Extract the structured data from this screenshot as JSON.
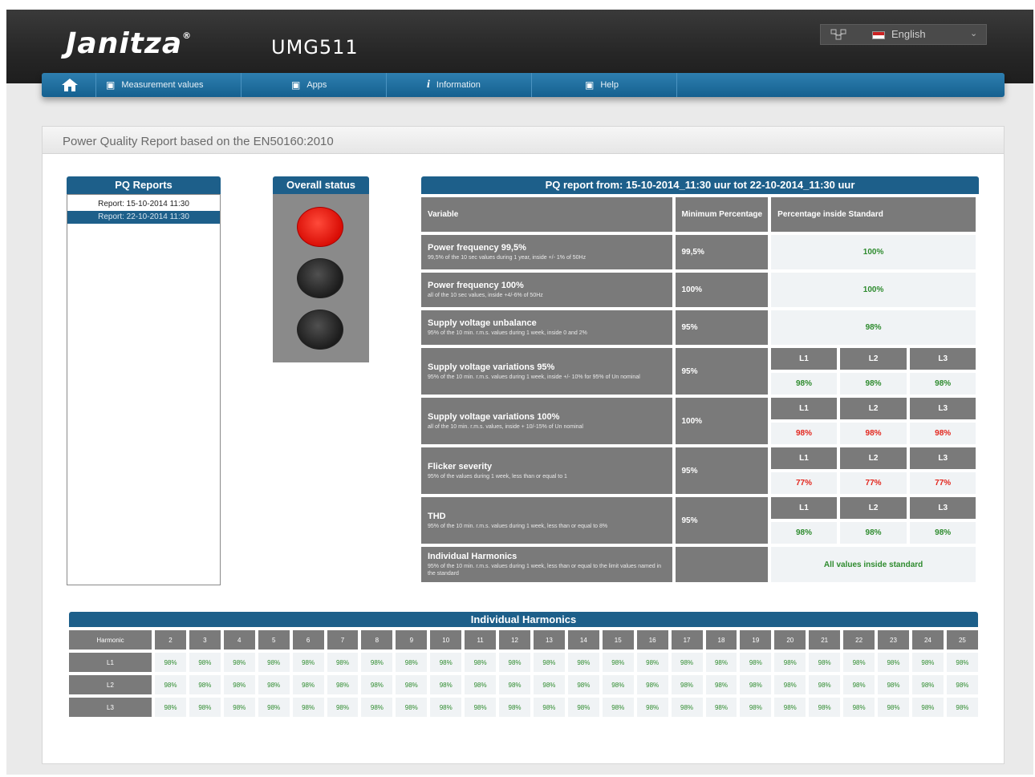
{
  "header": {
    "brand": "Janitza",
    "brand_mark": "®",
    "model": "UMG511",
    "network_icon": "network-icon",
    "language": "English"
  },
  "nav": {
    "home_icon": "home-icon",
    "items": [
      {
        "label": "Measurement values",
        "icon": "monitor-icon"
      },
      {
        "label": "Apps",
        "icon": "apps-icon"
      },
      {
        "label": "Information",
        "icon": "info-icon"
      },
      {
        "label": "Help",
        "icon": "help-icon"
      }
    ]
  },
  "page_title": "Power Quality Report based on the EN50160:2010",
  "reports": {
    "title": "PQ Reports",
    "items": [
      "Report: 15-10-2014 11:30",
      "Report: 22-10-2014 11:30"
    ],
    "selected_index": 1
  },
  "status": {
    "title": "Overall status",
    "active_light": "red"
  },
  "pq": {
    "title": "PQ report from: 15-10-2014_11:30 uur tot 22-10-2014_11:30 uur",
    "col_variable": "Variable",
    "col_min": "Minimum Percentage",
    "col_inside": "Percentage inside Standard",
    "phases": [
      "L1",
      "L2",
      "L3"
    ],
    "rows": [
      {
        "name": "Power frequency 99,5%",
        "desc": "99,5% of the 10 sec values during 1 year, inside +/- 1% of 50Hz",
        "min": "99,5%",
        "value": "100%",
        "status": "ok"
      },
      {
        "name": "Power frequency 100%",
        "desc": "all of the 10 sec values, inside +4/-6% of 50Hz",
        "min": "100%",
        "value": "100%",
        "status": "ok"
      },
      {
        "name": "Supply voltage unbalance",
        "desc": "95% of the 10 min. r.m.s. values during 1 week, inside 0 and 2%",
        "min": "95%",
        "value": "98%",
        "status": "ok"
      },
      {
        "name": "Supply voltage variations 95%",
        "desc": "95% of the 10 min. r.m.s. values during 1 week, inside +/- 10% for 95% of Un nominal",
        "min": "95%",
        "values": [
          "98%",
          "98%",
          "98%"
        ],
        "status": "ok"
      },
      {
        "name": "Supply voltage variations 100%",
        "desc": "all of the 10 min. r.m.s. values, inside + 10/-15% of Un nominal",
        "min": "100%",
        "values": [
          "98%",
          "98%",
          "98%"
        ],
        "status": "bad"
      },
      {
        "name": "Flicker severity",
        "desc": "95% of the values during 1 week, less than or equal to 1",
        "min": "95%",
        "values": [
          "77%",
          "77%",
          "77%"
        ],
        "status": "bad"
      },
      {
        "name": "THD",
        "desc": "95% of the 10 min. r.m.s. values during 1 week, less than or equal to 8%",
        "min": "95%",
        "values": [
          "98%",
          "98%",
          "98%"
        ],
        "status": "ok"
      },
      {
        "name": "Individual Harmonics",
        "desc": "95% of the 10 min. r.m.s. values during 1 week, less than or equal to the limit values named in the standard",
        "min": "",
        "value": "All values inside standard",
        "status": "ok"
      }
    ]
  },
  "harmonics": {
    "title": "Individual Harmonics",
    "row_header": "Harmonic",
    "orders": [
      "2",
      "3",
      "4",
      "5",
      "6",
      "7",
      "8",
      "9",
      "10",
      "11",
      "12",
      "13",
      "14",
      "15",
      "16",
      "17",
      "18",
      "19",
      "20",
      "21",
      "22",
      "23",
      "24",
      "25"
    ],
    "rows": [
      {
        "label": "L1",
        "values": [
          "98%",
          "98%",
          "98%",
          "98%",
          "98%",
          "98%",
          "98%",
          "98%",
          "98%",
          "98%",
          "98%",
          "98%",
          "98%",
          "98%",
          "98%",
          "98%",
          "98%",
          "98%",
          "98%",
          "98%",
          "98%",
          "98%",
          "98%",
          "98%"
        ]
      },
      {
        "label": "L2",
        "values": [
          "98%",
          "98%",
          "98%",
          "98%",
          "98%",
          "98%",
          "98%",
          "98%",
          "98%",
          "98%",
          "98%",
          "98%",
          "98%",
          "98%",
          "98%",
          "98%",
          "98%",
          "98%",
          "98%",
          "98%",
          "98%",
          "98%",
          "98%",
          "98%"
        ]
      },
      {
        "label": "L3",
        "values": [
          "98%",
          "98%",
          "98%",
          "98%",
          "98%",
          "98%",
          "98%",
          "98%",
          "98%",
          "98%",
          "98%",
          "98%",
          "98%",
          "98%",
          "98%",
          "98%",
          "98%",
          "98%",
          "98%",
          "98%",
          "98%",
          "98%",
          "98%",
          "98%"
        ]
      }
    ]
  },
  "colors": {
    "accent": "#1d5f8a",
    "ok": "#2e8b2e",
    "bad": "#e3261d",
    "alarm_light": "#f22a1c"
  }
}
